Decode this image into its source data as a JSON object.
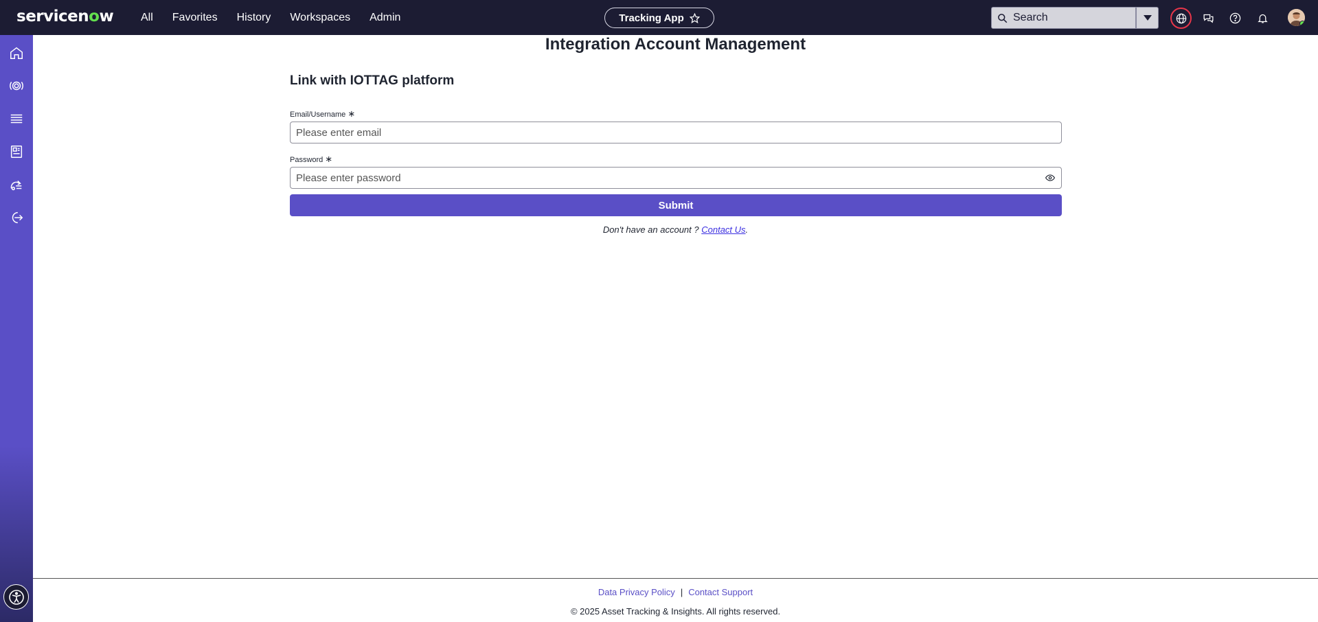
{
  "brand": {
    "logo_text_pre": "servicen",
    "logo_text_o": "o",
    "logo_text_post": "w"
  },
  "nav": {
    "items": [
      "All",
      "Favorites",
      "History",
      "Workspaces",
      "Admin"
    ]
  },
  "app_pill": {
    "label": "Tracking App"
  },
  "search": {
    "placeholder": "Search"
  },
  "page": {
    "title": "Integration Account Management",
    "section_title": "Link with IOTTAG platform",
    "email_label": "Email/Username",
    "email_placeholder": "Please enter email",
    "password_label": "Password",
    "password_placeholder": "Please enter password",
    "required_mark": "∗",
    "submit_label": "Submit",
    "account_prompt": "Don't have an account ? ",
    "contact_link": "Contact Us",
    "account_suffix": "."
  },
  "footer": {
    "privacy_link": "Data Privacy Policy",
    "separator": "|",
    "support_link": "Contact Support",
    "copyright": "© 2025 Asset Tracking & Insights. All rights reserved."
  },
  "colors": {
    "topbar": "#1c1c33",
    "accent": "#5a4fc6",
    "logo_o": "#63df4e",
    "globe_ring": "#e8364a"
  },
  "icons": {
    "sidebar": [
      "home-icon",
      "asset-tracking-icon",
      "list-icon",
      "catalog-icon",
      "integration-icon",
      "logout-icon"
    ],
    "topbar": [
      "globe-icon",
      "chat-icon",
      "help-icon",
      "bell-icon"
    ]
  }
}
